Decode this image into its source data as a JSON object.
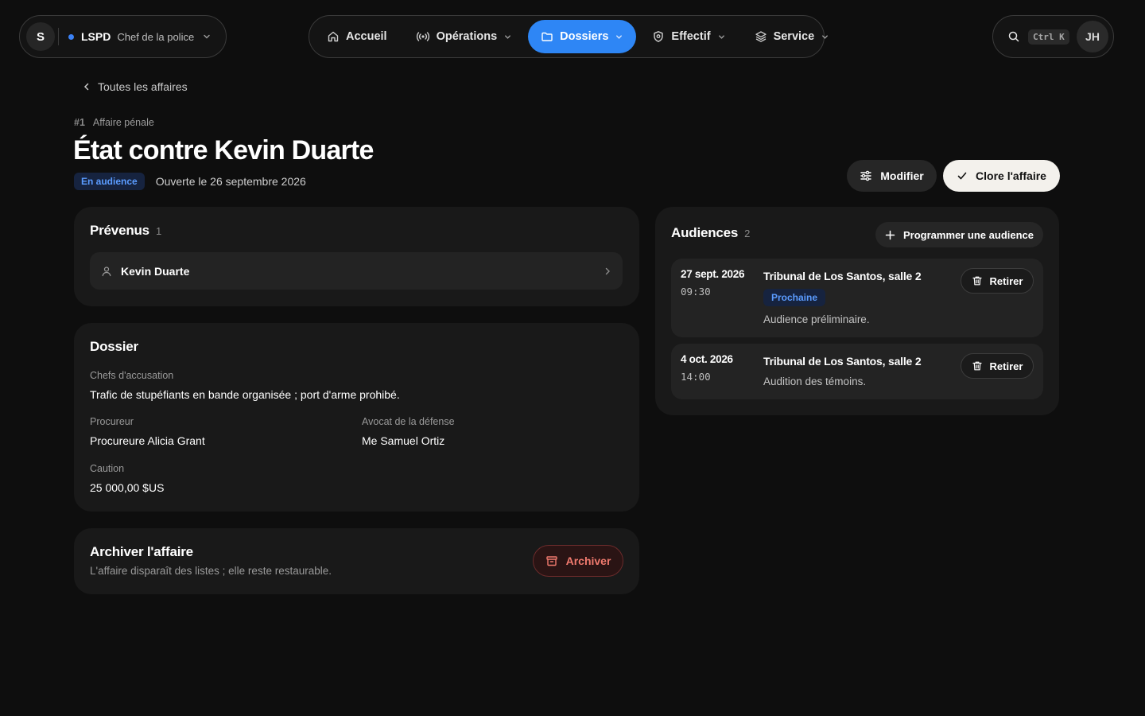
{
  "org": {
    "avatar_letter": "S",
    "name": "LSPD",
    "role": "Chef de la police"
  },
  "nav": {
    "items": [
      {
        "label": "Accueil"
      },
      {
        "label": "Opérations"
      },
      {
        "label": "Dossiers"
      },
      {
        "label": "Effectif"
      },
      {
        "label": "Service"
      }
    ],
    "active": "Dossiers"
  },
  "tools": {
    "shortcut": "Ctrl K",
    "user_initials": "JH"
  },
  "breadcrumb": {
    "back_label": "Toutes les affaires"
  },
  "case": {
    "number": "#1",
    "type": "Affaire pénale",
    "title": "État contre Kevin Duarte",
    "status": "En audience",
    "opened": "Ouverte le 26 septembre 2026"
  },
  "actions": {
    "modify_label": "Modifier",
    "close_label": "Clore l'affaire"
  },
  "defendants": {
    "title": "Prévenus",
    "count": "1",
    "items": [
      {
        "name": "Kevin Duarte"
      }
    ]
  },
  "dossier": {
    "title": "Dossier",
    "charges_label": "Chefs d'accusation",
    "charges": "Trafic de stupéfiants en bande organisée ; port d'arme prohibé.",
    "prosecutor_label": "Procureur",
    "prosecutor": "Procureure Alicia Grant",
    "defense_label": "Avocat de la défense",
    "defense": "Me Samuel Ortiz",
    "bail_label": "Caution",
    "bail": "25 000,00 $US"
  },
  "archive": {
    "title": "Archiver l'affaire",
    "description": "L'affaire disparaît des listes ; elle reste restaurable.",
    "button_label": "Archiver"
  },
  "hearings": {
    "title": "Audiences",
    "count": "2",
    "add_label": "Programmer une audience",
    "remove_label": "Retirer",
    "items": [
      {
        "date": "27 sept. 2026",
        "time": "09:30",
        "place": "Tribunal de Los Santos, salle 2",
        "badge": "Prochaine",
        "note": "Audience préliminaire."
      },
      {
        "date": "4 oct. 2026",
        "time": "14:00",
        "place": "Tribunal de Los Santos, salle 2",
        "note": "Audition des témoins."
      }
    ]
  },
  "colors": {
    "accent": "#2e86f5",
    "background": "#0e0e0e",
    "card": "#191919",
    "danger": "#f07a6e"
  }
}
